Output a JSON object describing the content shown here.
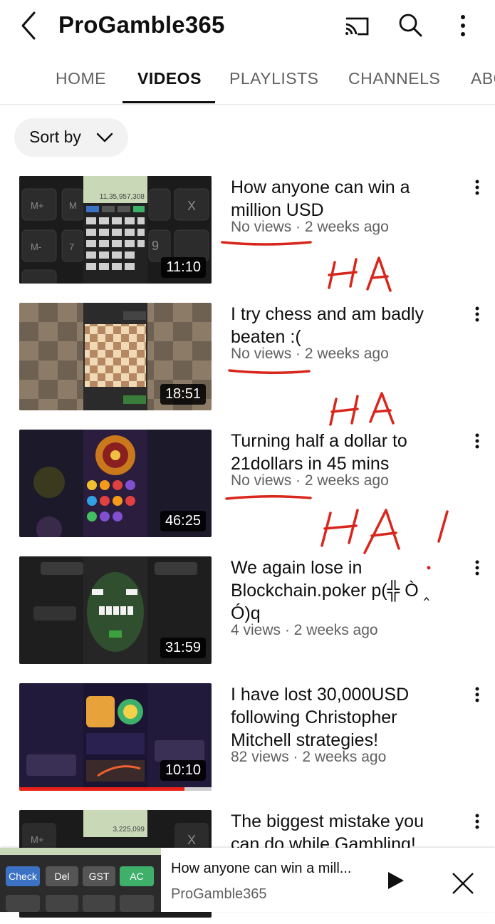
{
  "header": {
    "channel_name": "ProGamble365",
    "icons": [
      "back-arrow-icon",
      "cast-icon",
      "search-icon",
      "more-vertical-icon"
    ]
  },
  "tabs": [
    {
      "label": "HOME",
      "active": false
    },
    {
      "label": "VIDEOS",
      "active": true
    },
    {
      "label": "PLAYLISTS",
      "active": false
    },
    {
      "label": "CHANNELS",
      "active": false
    },
    {
      "label": "ABOUT",
      "active": false
    }
  ],
  "sort": {
    "label": "Sort by"
  },
  "videos": [
    {
      "title": "How anyone can win a million USD",
      "meta": "No views · 2 weeks ago",
      "duration": "11:10",
      "thumb_text": "11,35,957,308"
    },
    {
      "title": "I try chess and am badly beaten :(",
      "meta": "No views · 2 weeks ago",
      "duration": "18:51"
    },
    {
      "title": "Turning half a dollar to 21dollars in 45 mins",
      "meta": "No views · 2 weeks ago",
      "duration": "46:25"
    },
    {
      "title": "We again lose in Blockchain.poker p(╬ Ò ‸ Ó)q",
      "meta": "4 views · 2 weeks ago",
      "duration": "31:59"
    },
    {
      "title": "I have lost 30,000USD following Christopher Mitchell strategies!",
      "meta": "82 views · 2 weeks ago",
      "duration": "10:10",
      "watch_progress": 0.86
    },
    {
      "title": "The biggest mistake you can do while Gambling!",
      "meta": "",
      "duration": "",
      "thumb_text": "3,225,099"
    }
  ],
  "mini_player": {
    "title": "How anyone can win a mill...",
    "channel": "ProGamble365",
    "buttons": [
      "Check",
      "Del",
      "GST",
      "AC"
    ]
  },
  "annotations": [
    "HA",
    "HA",
    "HA!"
  ],
  "colors": {
    "accent_red": "#e62117",
    "annotation_red": "#d8261c",
    "text_secondary": "#606060"
  }
}
